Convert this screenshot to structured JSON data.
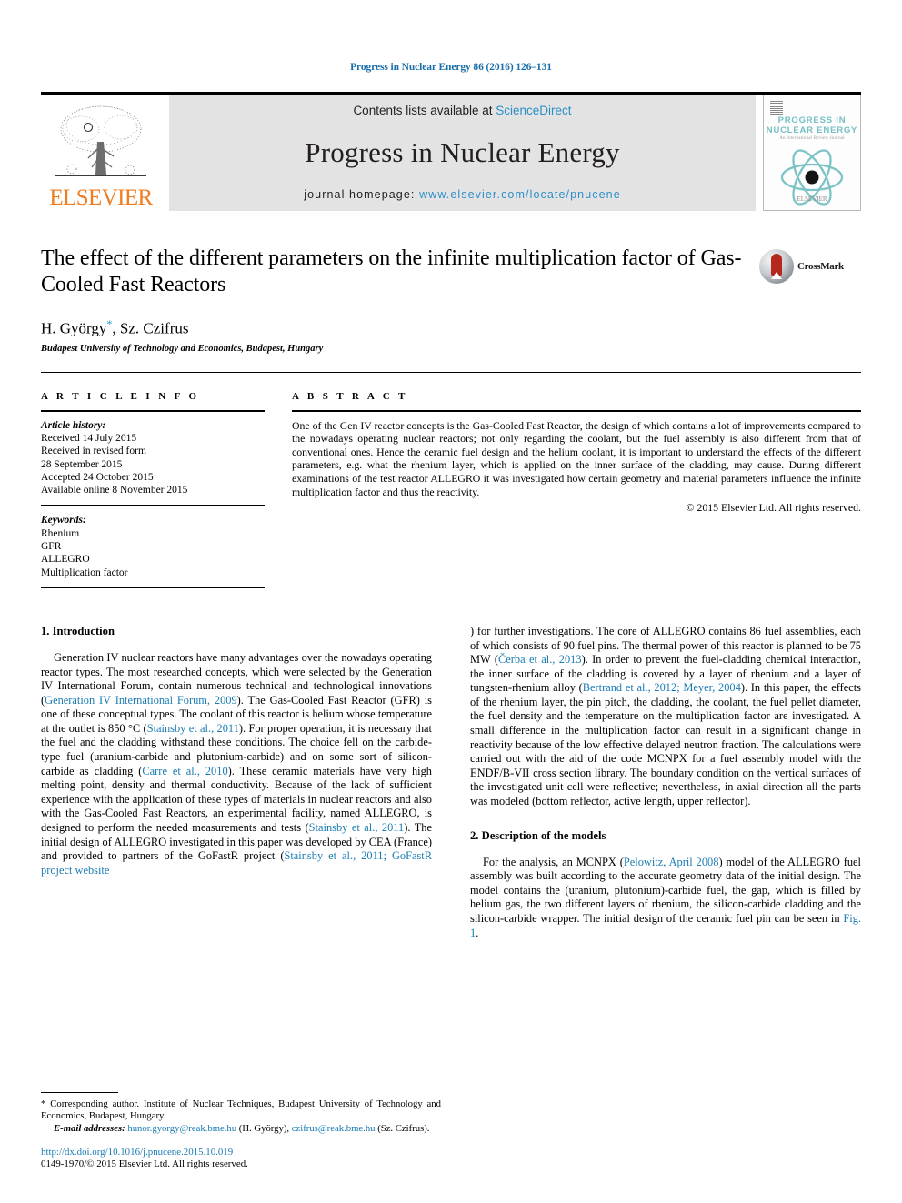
{
  "running_head": "Progress in Nuclear Energy 86 (2016) 126–131",
  "masthead": {
    "publisher_logo_text": "ELSEVIER",
    "contents_prefix": "Contents lists available at ",
    "contents_link": "ScienceDirect",
    "journal_name": "Progress in Nuclear Energy",
    "homepage_prefix": "journal homepage: ",
    "homepage_url": "www.elsevier.com/locate/pnucene",
    "cover": {
      "title": "PROGRESS IN NUCLEAR ENERGY",
      "subtitle": "An International Review Journal",
      "footer": "ELSEVIER"
    }
  },
  "article": {
    "title": "The effect of the different parameters on the infinite multiplication factor of Gas-Cooled Fast Reactors",
    "authors": "H. György",
    "authors_rest": ", Sz. Czifrus",
    "corresponding_marker": "*",
    "affiliation": "Budapest University of Technology and Economics, Budapest, Hungary",
    "crossmark_label": "CrossMark"
  },
  "article_info": {
    "heading": "A R T I C L E  I N F O",
    "history_label": "Article history:",
    "history": [
      "Received 14 July 2015",
      "Received in revised form",
      "28 September 2015",
      "Accepted 24 October 2015",
      "Available online 8 November 2015"
    ],
    "keywords_label": "Keywords:",
    "keywords": [
      "Rhenium",
      "GFR",
      "ALLEGRO",
      "Multiplication factor"
    ]
  },
  "abstract": {
    "heading": "A B S T R A C T",
    "text": "One of the Gen IV reactor concepts is the Gas-Cooled Fast Reactor, the design of which contains a lot of improvements compared to the nowadays operating nuclear reactors; not only regarding the coolant, but the fuel assembly is also different from that of conventional ones. Hence the ceramic fuel design and the helium coolant, it is important to understand the effects of the different parameters, e.g. what the rhenium layer, which is applied on the inner surface of the cladding, may cause. During different examinations of the test reactor ALLEGRO it was investigated how certain geometry and material parameters influence the infinite multiplication factor and thus the reactivity.",
    "copyright": "© 2015 Elsevier Ltd. All rights reserved."
  },
  "sections": {
    "intro_heading": "1. Introduction",
    "models_heading": "2. Description of the models"
  },
  "paragraphs": {
    "intro_p1_a": "Generation IV nuclear reactors have many advantages over the nowadays operating reactor types. The most researched concepts, which were selected by the Generation IV International Forum, contain numerous technical and technological innovations (",
    "intro_ref1": "Generation IV International Forum, 2009",
    "intro_p1_b": "). The Gas-Cooled Fast Reactor (GFR) is one of these conceptual types. The coolant of this reactor is helium whose temperature at the outlet is 850 °C (",
    "intro_ref2": "Stainsby et al., 2011",
    "intro_p1_c": "). For proper operation, it is necessary that the fuel and the cladding withstand these conditions. The choice fell on the carbide-type fuel (uranium-carbide and plutonium-carbide) and on some sort of silicon-carbide as cladding (",
    "intro_ref3": "Carre et al., 2010",
    "intro_p1_d": "). These ceramic materials have very high melting point, density and thermal conductivity. Because of the lack of sufficient experience with the application of these types of materials in nuclear reactors and also with the Gas-Cooled Fast Reactors, an experimental facility, named ALLEGRO, is designed to perform the needed measurements and tests (",
    "intro_ref4": "Stainsby et al., 2011",
    "intro_p1_e": "). The initial design of ALLEGRO investigated in this paper was developed by CEA (France) and provided to partners of the GoFastR project (",
    "intro_ref5": "Stainsby et al., 2011; GoFastR project website",
    "intro_p1_f": ") for further investigations. The core of ALLEGRO contains 86 fuel assemblies, each of which consists of 90 fuel pins. The thermal power of this reactor is planned to be 75 MW (",
    "intro_ref6": "Čerba et al., 2013",
    "intro_p1_g": "). In order to prevent the fuel-cladding chemical interaction, the inner surface of the cladding is covered by a layer of rhenium and a layer of tungsten-rhenium alloy (",
    "intro_ref7": "Bertrand et al., 2012; Meyer, 2004",
    "intro_p1_h": "). In this paper, the effects of the rhenium layer, the pin pitch, the cladding, the coolant, the fuel pellet diameter, the fuel density and the temperature on the multiplication factor are investigated. A small difference in the multiplication factor can result in a significant change in reactivity because of the low effective delayed neutron fraction. The calculations were carried out with the aid of the code MCNPX for a fuel assembly model with the ENDF/B-VII cross section library. The boundary condition on the vertical surfaces of the investigated unit cell were reflective; nevertheless, in axial direction all the parts was modeled (bottom reflector, active length, upper reflector).",
    "models_p1_a": "For the analysis, an MCNPX (",
    "models_ref1": "Pelowitz, April 2008",
    "models_p1_b": ") model of the ALLEGRO fuel assembly was built according to the accurate geometry data of the initial design. The model contains the (uranium, plutonium)-carbide fuel, the gap, which is filled by helium gas, the two different layers of rhenium, the silicon-carbide cladding and the silicon-carbide wrapper. The initial design of the ceramic fuel pin can be seen in ",
    "models_ref2": "Fig. 1",
    "models_p1_c": "."
  },
  "footnote": {
    "marker": "*",
    "corresponding_text": " Corresponding author. Institute of Nuclear Techniques, Budapest University of Technology and Economics, Budapest, Hungary.",
    "email_label": "E-mail addresses:",
    "email1": "hunor.gyorgy@reak.bme.hu",
    "email1_name": " (H. György), ",
    "email2": "czifrus@reak.bme.hu",
    "email2_name": " (Sz. Czifrus)."
  },
  "doi": {
    "url": "http://dx.doi.org/10.1016/j.pnucene.2015.10.019",
    "issn_line": "0149-1970/© 2015 Elsevier Ltd. All rights reserved."
  },
  "colors": {
    "link": "#1a7bb3",
    "sciencedirect": "#2c8fc9",
    "elsevier_orange": "#ef7d22",
    "band_gray": "#e3e3e3",
    "cover_teal": "#76c0c4",
    "crossmark_red": "#b5281d"
  }
}
